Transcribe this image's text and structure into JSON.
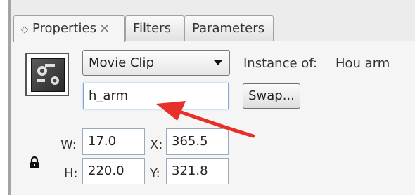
{
  "tabs": [
    {
      "label": "Properties",
      "active": true,
      "closable": true
    },
    {
      "label": "Filters",
      "active": false
    },
    {
      "label": "Parameters",
      "active": false
    }
  ],
  "symbol_icon": "movie-clip-symbol-icon",
  "type_select": {
    "value": "Movie Clip"
  },
  "instance": {
    "label": "Instance of:",
    "name": "Hou arm"
  },
  "instance_name_input": {
    "value": "h_arm"
  },
  "swap_button": {
    "label": "Swap..."
  },
  "dimensions": {
    "w_label": "W:",
    "w_value": "17.0",
    "h_label": "H:",
    "h_value": "220.0",
    "x_label": "X:",
    "x_value": "365.5",
    "y_label": "Y:",
    "y_value": "321.8"
  },
  "icons": {
    "lock": "lock-icon",
    "close": "close-icon",
    "grip": "panel-grip-icon",
    "dropdown": "chevron-down-icon"
  },
  "annotation": {
    "type": "red-arrow",
    "color": "#e8302a",
    "points_to": "instance_name_input"
  }
}
